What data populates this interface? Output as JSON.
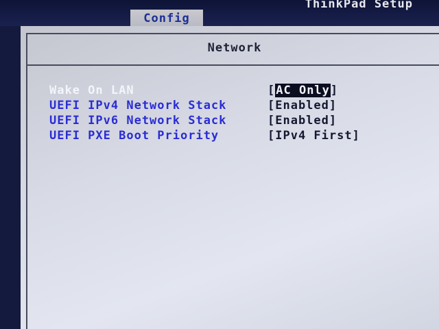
{
  "header": {
    "app_title": "ThinkPad Setup",
    "active_tab": "Config"
  },
  "section": {
    "title": "Network"
  },
  "settings": [
    {
      "label": "Wake On LAN",
      "value_open": "[",
      "value": "AC Only",
      "value_close": "]",
      "selected": true
    },
    {
      "label": "UEFI IPv4 Network Stack",
      "value_open": "",
      "value": "[Enabled]",
      "value_close": "",
      "selected": false
    },
    {
      "label": "UEFI IPv6 Network Stack",
      "value_open": "",
      "value": "[Enabled]",
      "value_close": "",
      "selected": false
    },
    {
      "label": "UEFI PXE Boot Priority",
      "value_open": "",
      "value": "[IPv4 First]",
      "value_close": "",
      "selected": false
    }
  ],
  "colors": {
    "option_label": "#2a2cd4",
    "selected_label": "#f4f4fb",
    "panel_bg": "#d8dbe6",
    "frame": "#474a5c",
    "tab_bg": "#c9c9ce",
    "tab_text": "#1b2f96"
  }
}
